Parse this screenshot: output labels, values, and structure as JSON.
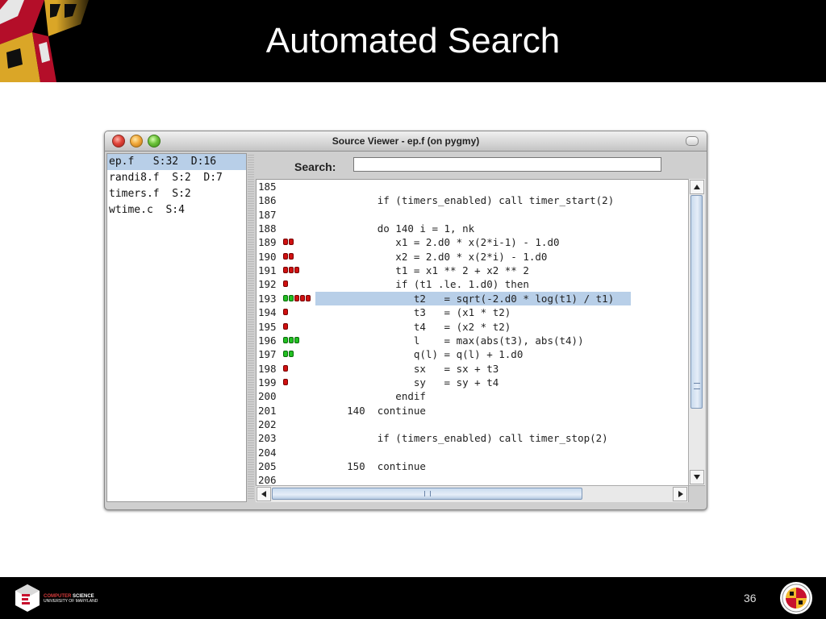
{
  "slide": {
    "title": "Automated Search",
    "page_number": "36",
    "footer_logo_line1_accent": "COMPUTER",
    "footer_logo_line1_rest": " SCIENCE",
    "footer_logo_line2": "UNIVERSITY OF MARYLAND"
  },
  "window": {
    "title": "Source Viewer - ep.f (on pygmy)"
  },
  "files": [
    {
      "label": "ep.f   S:32  D:16",
      "selected": true
    },
    {
      "label": "randi8.f  S:2  D:7",
      "selected": false
    },
    {
      "label": "timers.f  S:2",
      "selected": false
    },
    {
      "label": "wtime.c  S:4",
      "selected": false
    }
  ],
  "search": {
    "label": "Search:",
    "value": ""
  },
  "code_lines": [
    {
      "num": "185",
      "text": "",
      "markers": []
    },
    {
      "num": "186",
      "text": "         if (timers_enabled) call timer_start(2)",
      "markers": []
    },
    {
      "num": "187",
      "text": "",
      "markers": []
    },
    {
      "num": "188",
      "text": "         do 140 i = 1, nk",
      "markers": []
    },
    {
      "num": "189",
      "text": "            x1 = 2.d0 * x(2*i-1) - 1.d0",
      "markers": [
        "red",
        "red"
      ]
    },
    {
      "num": "190",
      "text": "            x2 = 2.d0 * x(2*i) - 1.d0",
      "markers": [
        "red",
        "red"
      ]
    },
    {
      "num": "191",
      "text": "            t1 = x1 ** 2 + x2 ** 2",
      "markers": [
        "red",
        "red",
        "red"
      ]
    },
    {
      "num": "192",
      "text": "            if (t1 .le. 1.d0) then",
      "markers": [
        "red"
      ]
    },
    {
      "num": "193",
      "text": "               t2   = sqrt(-2.d0 * log(t1) / t1)",
      "markers": [
        "green",
        "green",
        "red",
        "red",
        "red"
      ],
      "highlighted": true
    },
    {
      "num": "194",
      "text": "               t3   = (x1 * t2)",
      "markers": [
        "red"
      ]
    },
    {
      "num": "195",
      "text": "               t4   = (x2 * t2)",
      "markers": [
        "red"
      ]
    },
    {
      "num": "196",
      "text": "               l    = max(abs(t3), abs(t4))",
      "markers": [
        "green",
        "green",
        "green"
      ]
    },
    {
      "num": "197",
      "text": "               q(l) = q(l) + 1.d0",
      "markers": [
        "green",
        "green"
      ]
    },
    {
      "num": "198",
      "text": "               sx   = sx + t3",
      "markers": [
        "red"
      ]
    },
    {
      "num": "199",
      "text": "               sy   = sy + t4",
      "markers": [
        "red"
      ]
    },
    {
      "num": "200",
      "text": "            endif",
      "markers": []
    },
    {
      "num": "201",
      "text": "    140  continue",
      "markers": []
    },
    {
      "num": "202",
      "text": "",
      "markers": []
    },
    {
      "num": "203",
      "text": "         if (timers_enabled) call timer_stop(2)",
      "markers": []
    },
    {
      "num": "204",
      "text": "",
      "markers": []
    },
    {
      "num": "205",
      "text": "    150  continue",
      "markers": []
    },
    {
      "num": "206",
      "text": "",
      "markers": []
    }
  ],
  "colors": {
    "selection": "#b8cfe8",
    "marker_red": "#d01010",
    "marker_green": "#22c022",
    "header_bg": "#000000"
  }
}
